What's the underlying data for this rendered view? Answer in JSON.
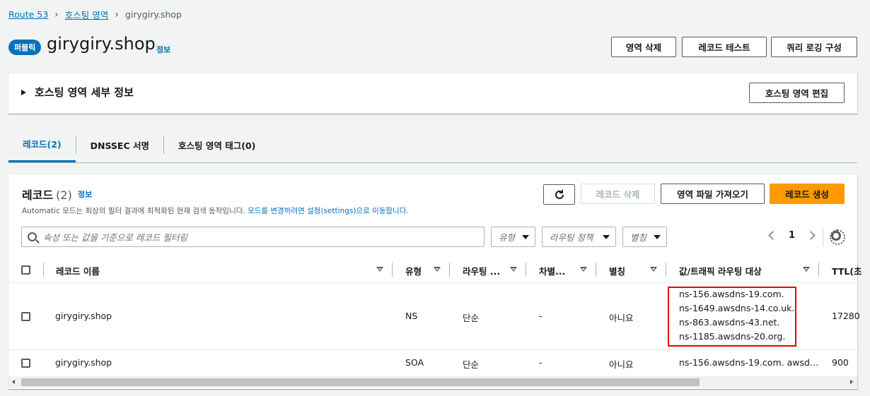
{
  "breadcrumb": {
    "items": [
      "Route 53",
      "호스팅 영역"
    ],
    "current": "girygiry.shop"
  },
  "header": {
    "badge": "퍼블릭",
    "title": "girygiry.shop",
    "info": "정보",
    "buttons": {
      "delete_zone": "영역 삭제",
      "test_record": "레코드 테스트",
      "query_logging": "쿼리 로깅 구성"
    }
  },
  "details": {
    "title": "호스팅 영역 세부 정보",
    "edit_button": "호스팅 영역 편집"
  },
  "tabs": [
    {
      "label": "레코드(2)",
      "active": true
    },
    {
      "label": "DNSSEC 서명",
      "active": false
    },
    {
      "label": "호스팅 영역 태그(0)",
      "active": false
    }
  ],
  "records": {
    "title": "레코드",
    "count": "(2)",
    "info": "정보",
    "desc_prefix": "Automatic 모드는 최상의 필터 결과에 최적화된 현재 검색 동작입니다.",
    "desc_link": "모드를 변경하려면 설정(settings)으로 이동합니다.",
    "buttons": {
      "delete": "레코드 삭제",
      "import": "영역 파일 가져오기",
      "create": "레코드 생성"
    },
    "search_placeholder": "속성 또는 값을 기준으로 레코드 필터링",
    "filters": {
      "type": "유형",
      "routing": "라우팅 정책",
      "alias": "별칭"
    },
    "page": "1",
    "columns": [
      "레코드 이름",
      "유형",
      "라우팅 ...",
      "차별...",
      "별칭",
      "값/트래픽 라우팅 대상",
      "TTL(초"
    ],
    "rows": [
      {
        "name": "girygiry.shop",
        "type": "NS",
        "routing": "단순",
        "diff": "-",
        "alias": "아니요",
        "values": [
          "ns-156.awsdns-19.com.",
          "ns-1649.awsdns-14.co.uk.",
          "ns-863.awsdns-43.net.",
          "ns-1185.awsdns-20.org."
        ],
        "ttl": "17280"
      },
      {
        "name": "girygiry.shop",
        "type": "SOA",
        "routing": "단순",
        "diff": "-",
        "alias": "아니요",
        "value": "ns-156.awsdns-19.com. awsd…",
        "ttl": "900"
      }
    ]
  },
  "colors": {
    "link": "#0073bb",
    "primary": "#ff9900",
    "highlight": "#e00000"
  }
}
